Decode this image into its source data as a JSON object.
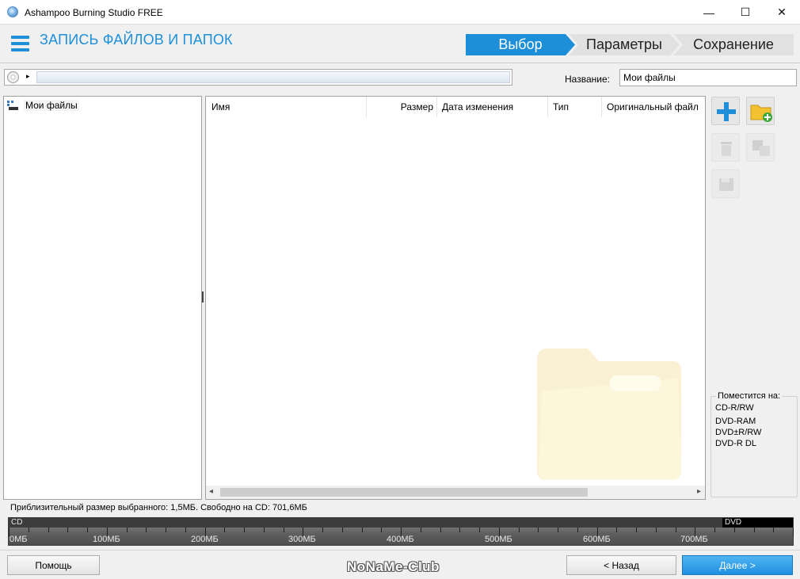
{
  "window": {
    "title": "Ashampoo Burning Studio FREE",
    "min_glyph": "—",
    "max_glyph": "☐",
    "close_glyph": "✕"
  },
  "header": {
    "title": "ЗАПИСЬ ФАЙЛОВ И ПАПОК",
    "steps": [
      "Выбор",
      "Параметры",
      "Сохранение"
    ],
    "active_step": 0
  },
  "path_bar": {
    "arrow": "▸"
  },
  "name_field": {
    "label": "Название:",
    "value": "Мои файлы"
  },
  "tree": {
    "root_label": "Мои файлы"
  },
  "file_list": {
    "columns": [
      "Имя",
      "Размер",
      "Дата изменения",
      "Тип",
      "Оригинальный файл"
    ],
    "rows": [],
    "scroll_left": "◂",
    "scroll_right": "▸"
  },
  "toolbar": {
    "icons": [
      "add-icon",
      "add-folder-icon",
      "delete-icon",
      "rename-icon",
      "save-icon"
    ]
  },
  "fits_on": {
    "title": "Поместится на:",
    "items": [
      "CD-R/RW",
      "DVD-RAM",
      "DVD±R/RW",
      "DVD-R DL"
    ]
  },
  "size_info": {
    "text": "Приблизительный размер выбранного: 1,5МБ. Свободно на CD: 701,6МБ"
  },
  "gauge": {
    "band_cd": "CD",
    "band_dvd": "DVD",
    "max_mb": 800,
    "cd_capacity_mb": 703,
    "used_mb": 1.5,
    "tick_labels": [
      "0МБ",
      "100МБ",
      "200МБ",
      "300МБ",
      "400МБ",
      "500МБ",
      "600МБ",
      "700МБ"
    ]
  },
  "footer": {
    "help": "Помощь",
    "brand": "NoNaMe-Club",
    "back": "< Назад",
    "next": "Далее >"
  },
  "colors": {
    "accent": "#1e8fd8",
    "primary_button": "#1f90e0"
  }
}
